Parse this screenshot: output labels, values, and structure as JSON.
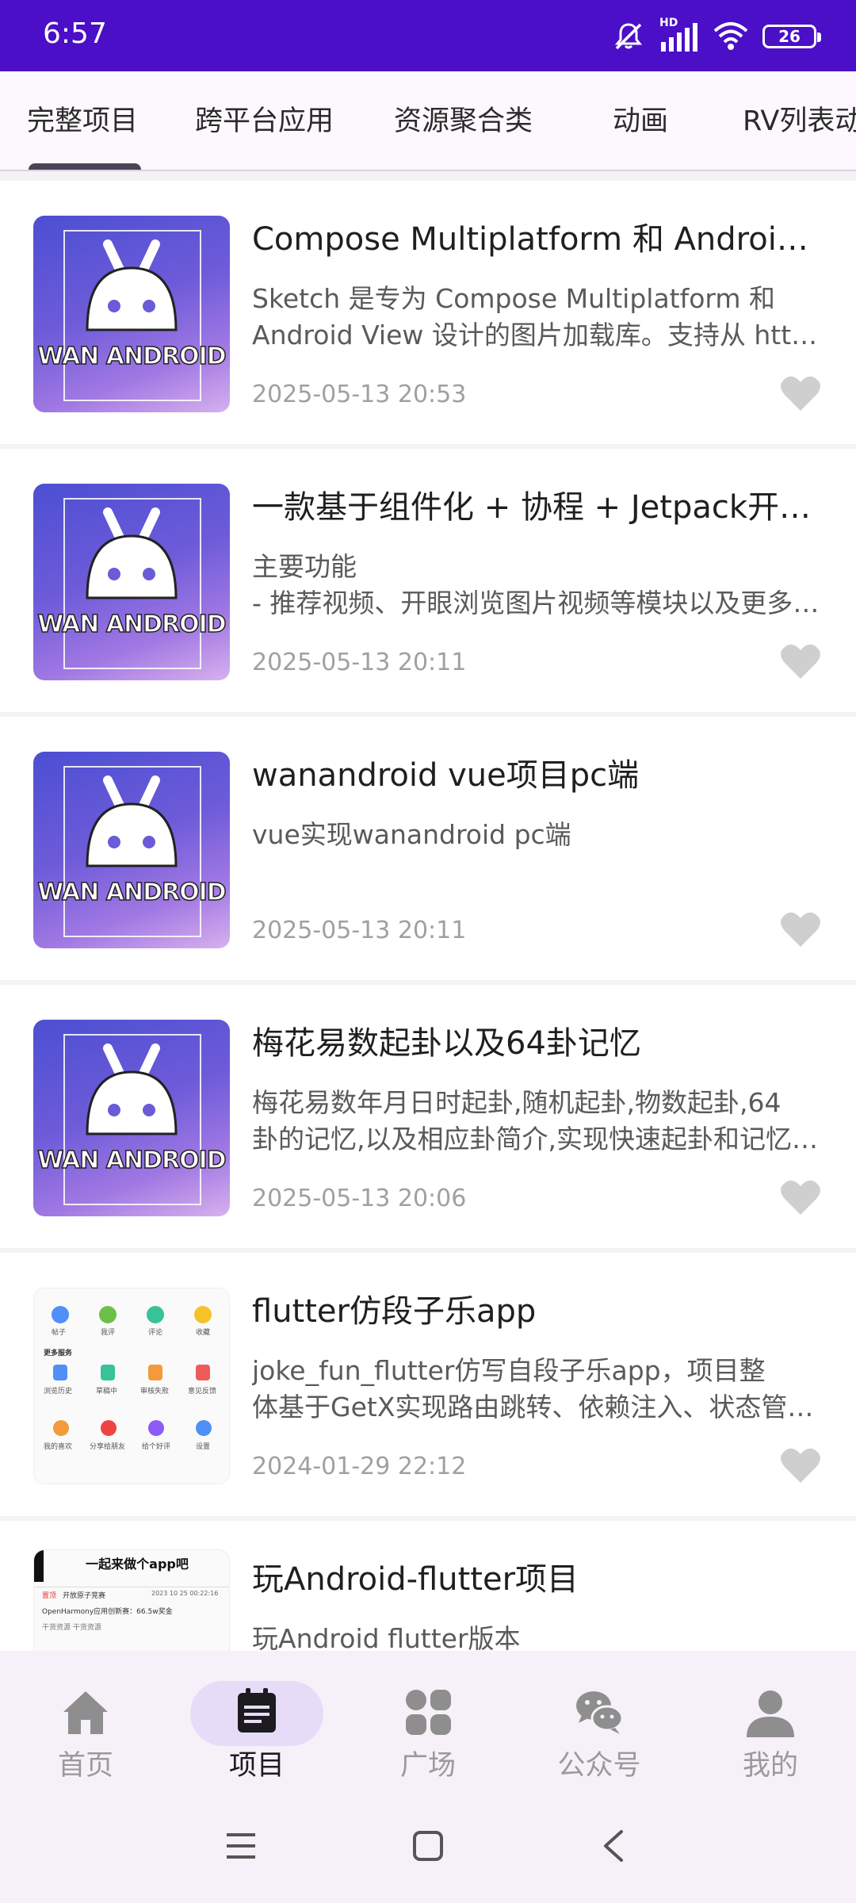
{
  "status_bar": {
    "time": "6:57",
    "network_label": "HD",
    "battery": "26"
  },
  "tabs": [
    {
      "label": "完整项目",
      "active": true
    },
    {
      "label": "跨平台应用",
      "active": false
    },
    {
      "label": "资源聚合类",
      "active": false
    },
    {
      "label": "动画",
      "active": false
    },
    {
      "label": "RV列表动",
      "active": false
    }
  ],
  "thumb_brand": "WAN ANDROID",
  "projects": [
    {
      "title": "Compose Multiplatform 和 Android View 设计的图片加载库",
      "desc1": "Sketch 是专为 Compose Multiplatform 和",
      "desc2": "Android View 设计的图片加载库。支持从 http、文件等多种来源加载图片",
      "date": "2025-05-13 20:53"
    },
    {
      "title": "一款基于组件化 + 协程 + Jetpack开发的应用",
      "desc1": "主要功能",
      "desc2": "- 推荐视频、开眼浏览图片视频等模块以及更多功能",
      "date": "2025-05-13 20:11"
    },
    {
      "title": "wanandroid vue项目pc端",
      "desc1": "vue实现wanandroid pc端",
      "desc2": "",
      "date": "2025-05-13 20:11"
    },
    {
      "title": "梅花易数起卦以及64卦记忆",
      "desc1": "梅花易数年月日时起卦,随机起卦,物数起卦,64",
      "desc2": "卦的记忆,以及相应卦简介,实现快速起卦和记忆卦象",
      "date": "2025-05-13 20:06"
    },
    {
      "title": "flutter仿段子乐app",
      "desc1": "joke_fun_flutter仿写自段子乐app，项目整",
      "desc2": "体基于GetX实现路由跳转、依赖注入、状态管理等功能",
      "date": "2024-01-29 22:12"
    },
    {
      "title": "玩Android-flutter项目",
      "desc1": "玩Android flutter版本",
      "desc2": "",
      "date": ""
    }
  ],
  "shot5": {
    "row1": [
      "帖子",
      "我评",
      "评论",
      "收藏"
    ],
    "section": "更多服务",
    "row2": [
      "浏览历史",
      "草稿中",
      "审核失败",
      "意见反馈"
    ],
    "row3": [
      "我的喜欢",
      "分享给朋友",
      "给个好评",
      "设置"
    ]
  },
  "shot6": {
    "banner": "一起来做个app吧",
    "line1_tag": "置顶",
    "line1_text": "开放原子竞赛",
    "line1_date": "2023 10 25 00:22:16",
    "line2": "OpenHarmony应用创新赛：66.5w奖金",
    "line3": "干货资源 干货资源"
  },
  "bottom_nav": [
    {
      "label": "首页",
      "icon": "home-icon",
      "active": false
    },
    {
      "label": "项目",
      "icon": "project-icon",
      "active": true
    },
    {
      "label": "广场",
      "icon": "square-grid-icon",
      "active": false
    },
    {
      "label": "公众号",
      "icon": "wechat-icon",
      "active": false
    },
    {
      "label": "我的",
      "icon": "person-icon",
      "active": false
    }
  ],
  "colors": {
    "status_bar": "#4a0fc7",
    "nav_pill": "#e6dcf8",
    "heart": "#cfcfcf"
  }
}
